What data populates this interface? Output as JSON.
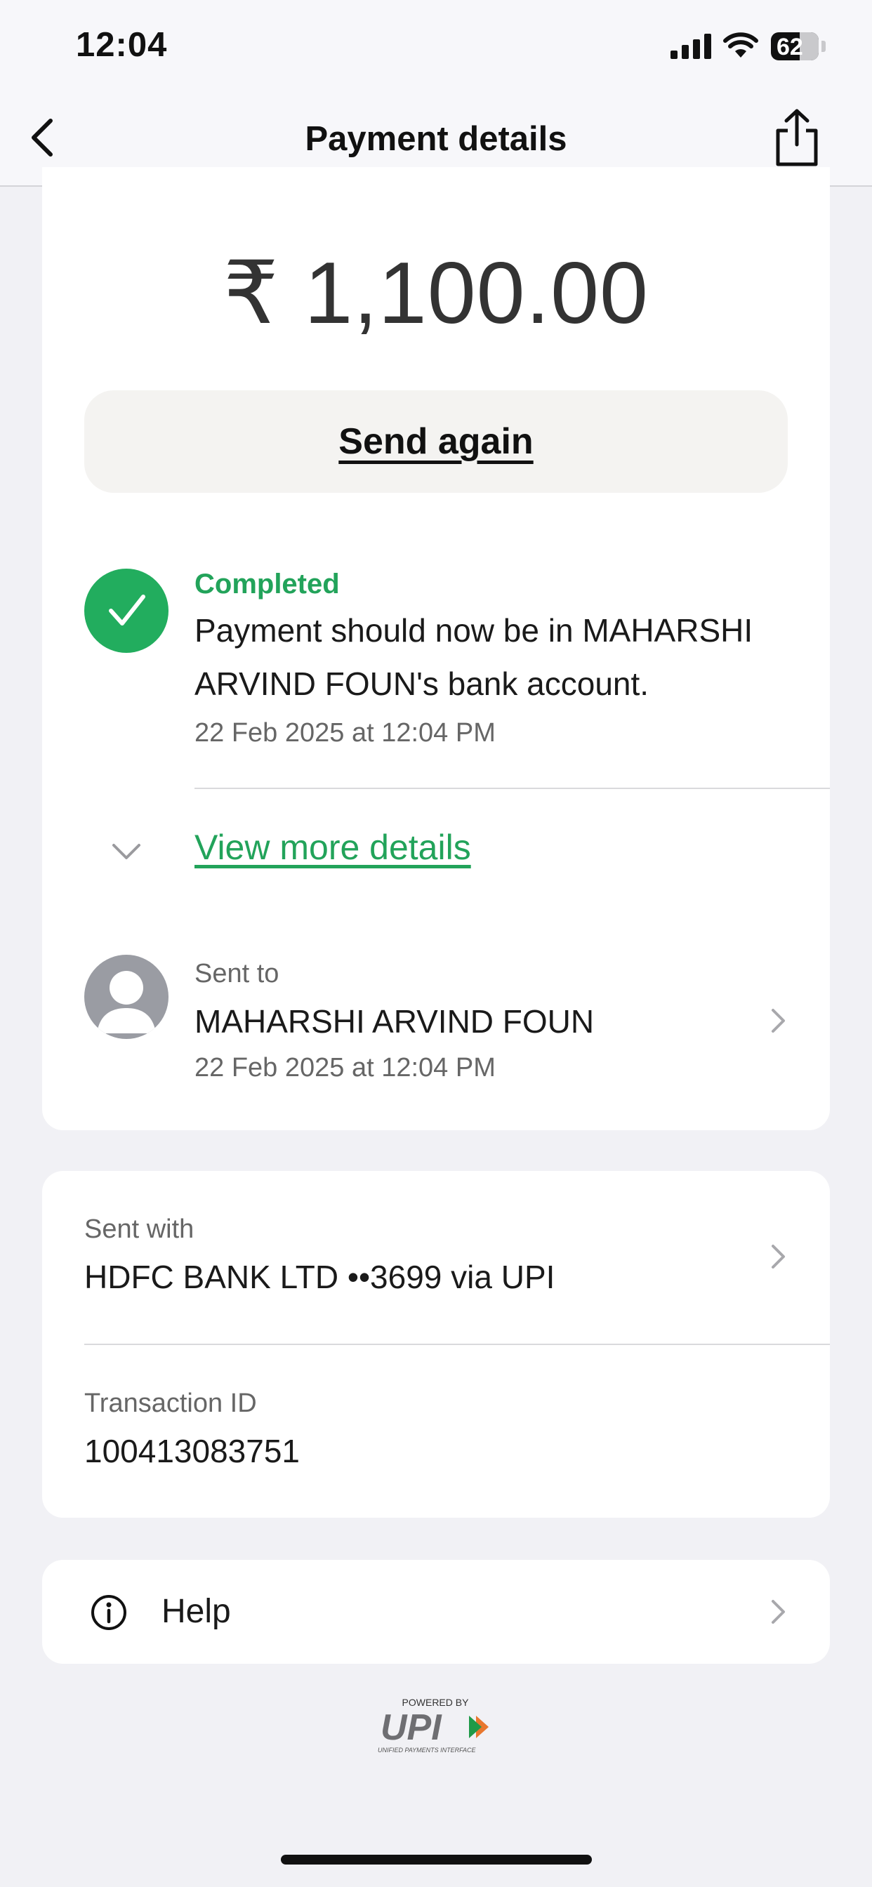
{
  "status_bar": {
    "time": "12:04",
    "battery_level": "62"
  },
  "nav": {
    "title": "Payment details",
    "back_icon": "chevron-left-icon",
    "share_icon": "share-icon"
  },
  "payment": {
    "amount": "₹ 1,100.00",
    "send_again_label": "Send again"
  },
  "status": {
    "label": "Completed",
    "message": "Payment should now be in MAHARSHI ARVIND FOUN's bank account.",
    "timestamp": "22 Feb 2025 at 12:04 PM",
    "color": "#22a35a"
  },
  "details": {
    "view_more_label": "View more details"
  },
  "recipient": {
    "label": "Sent to",
    "name": "MAHARSHI ARVIND FOUN",
    "timestamp": "22 Feb 2025 at 12:04 PM"
  },
  "payment_method": {
    "label": "Sent with",
    "value": "HDFC BANK LTD ••3699 via UPI"
  },
  "transaction": {
    "label": "Transaction ID",
    "value": "100413083751"
  },
  "help": {
    "label": "Help"
  },
  "footer": {
    "powered_by": "POWERED BY",
    "brand": "UPI",
    "brand_subtitle": "UNIFIED PAYMENTS INTERFACE"
  }
}
